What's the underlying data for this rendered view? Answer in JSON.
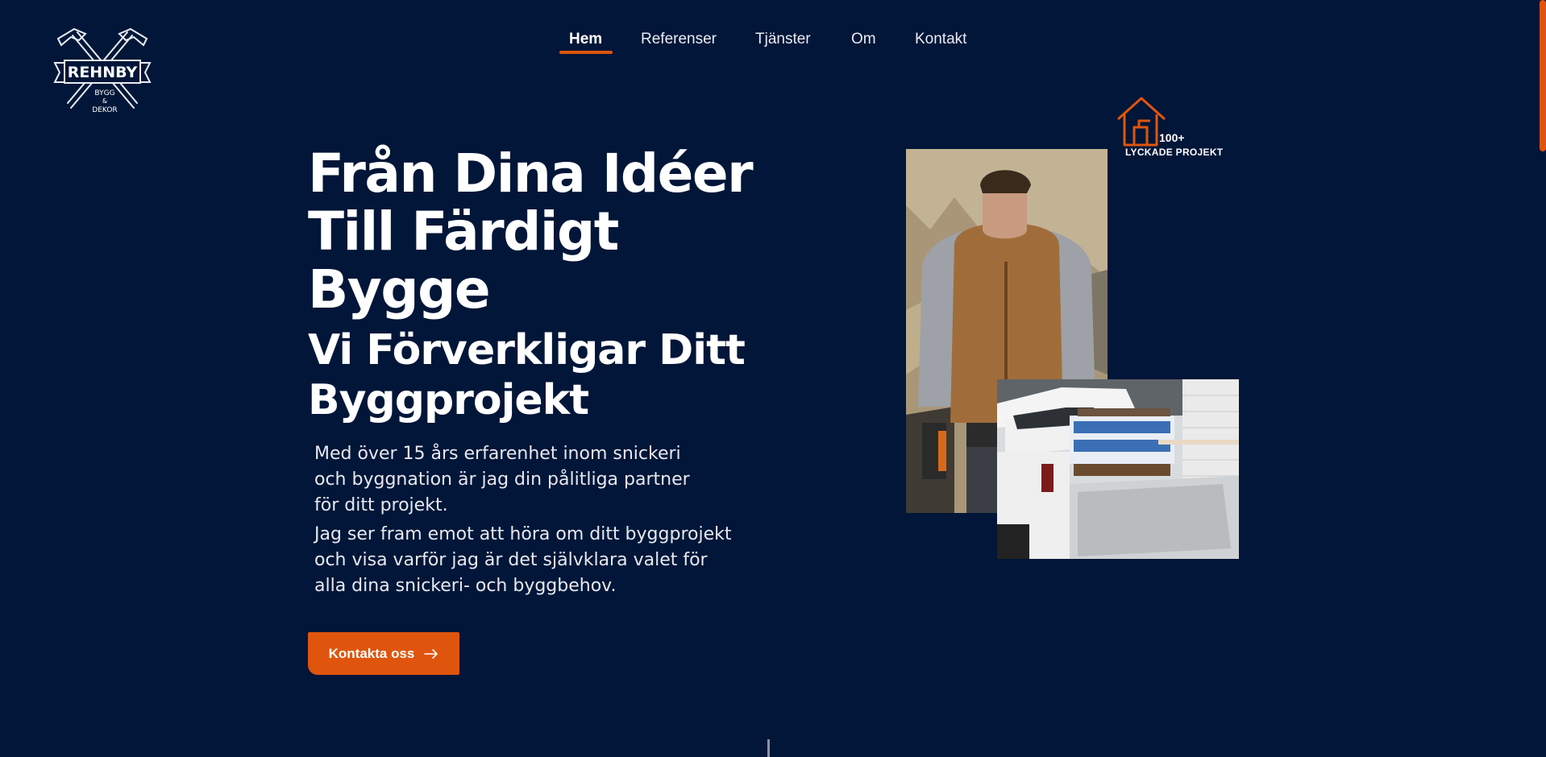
{
  "brand": {
    "name": "REHNBY",
    "tagline_1": "BYGG",
    "tagline_2": "&",
    "tagline_3": "DEKOR",
    "icon": "crossed-hammers-icon"
  },
  "nav": {
    "items": [
      {
        "label": "Hem",
        "active": true
      },
      {
        "label": "Referenser",
        "active": false
      },
      {
        "label": "Tjänster",
        "active": false
      },
      {
        "label": "Om",
        "active": false
      },
      {
        "label": "Kontakt",
        "active": false
      }
    ]
  },
  "hero": {
    "title_line_1": "Från Dina Idéer",
    "title_line_2": "Till Färdigt",
    "title_line_3": "Bygge",
    "subtitle_line_1": "Vi Förverkligar Ditt",
    "subtitle_line_2": "Byggprojekt",
    "paragraph_1": "Med över 15 års erfarenhet inom snickeri och byggnation är jag din pålitliga partner för ditt projekt.",
    "paragraph_2": "Jag ser fram emot att höra om ditt byggprojekt och visa varför jag är det självklara valet för alla dina snickeri- och byggbehov.",
    "cta_label": "Kontakta oss",
    "cta_icon": "arrow-right-icon"
  },
  "badge": {
    "count": "100+",
    "label": "LYCKADE PROJEKT",
    "icon": "house-icon"
  },
  "colors": {
    "background": "#011638",
    "accent": "#e0550d",
    "text": "#ffffff"
  }
}
